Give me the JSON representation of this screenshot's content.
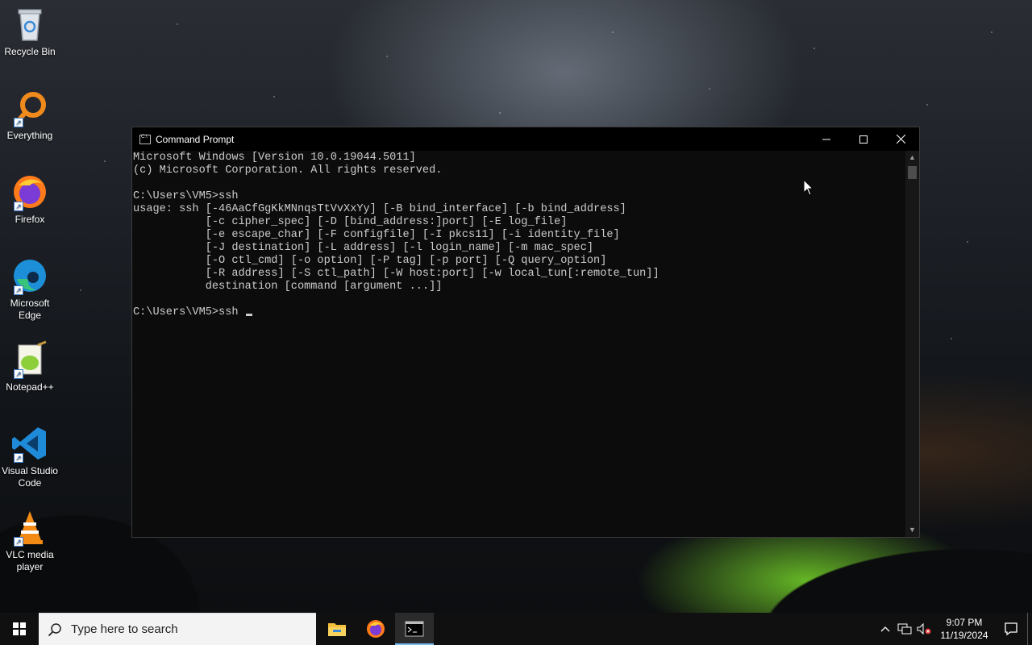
{
  "desktop": {
    "icons": [
      {
        "label": "Recycle Bin",
        "icon": "recycle-bin-icon"
      },
      {
        "label": "Everything",
        "icon": "everything-search-icon"
      },
      {
        "label": "Firefox",
        "icon": "firefox-icon"
      },
      {
        "label": "Microsoft Edge",
        "icon": "edge-icon"
      },
      {
        "label": "Notepad++",
        "icon": "notepad-plus-plus-icon"
      },
      {
        "label": "Visual Studio Code",
        "icon": "vscode-icon"
      },
      {
        "label": "VLC media player",
        "icon": "vlc-icon"
      }
    ]
  },
  "window": {
    "title": "Command Prompt",
    "lines": [
      "Microsoft Windows [Version 10.0.19044.5011]",
      "(c) Microsoft Corporation. All rights reserved.",
      "",
      "C:\\Users\\VM5>ssh",
      "usage: ssh [-46AaCfGgKkMNnqsTtVvXxYy] [-B bind_interface] [-b bind_address]",
      "           [-c cipher_spec] [-D [bind_address:]port] [-E log_file]",
      "           [-e escape_char] [-F configfile] [-I pkcs11] [-i identity_file]",
      "           [-J destination] [-L address] [-l login_name] [-m mac_spec]",
      "           [-O ctl_cmd] [-o option] [-P tag] [-p port] [-Q query_option]",
      "           [-R address] [-S ctl_path] [-W host:port] [-w local_tun[:remote_tun]]",
      "           destination [command [argument ...]]",
      ""
    ],
    "prompt_line": "C:\\Users\\VM5>ssh "
  },
  "taskbar": {
    "search_placeholder": "Type here to search",
    "pinned": [
      "file-explorer-icon",
      "firefox-icon",
      "command-prompt-icon"
    ],
    "clock_time": "9:07 PM",
    "clock_date": "11/19/2024",
    "accent": "#76b9ed"
  }
}
